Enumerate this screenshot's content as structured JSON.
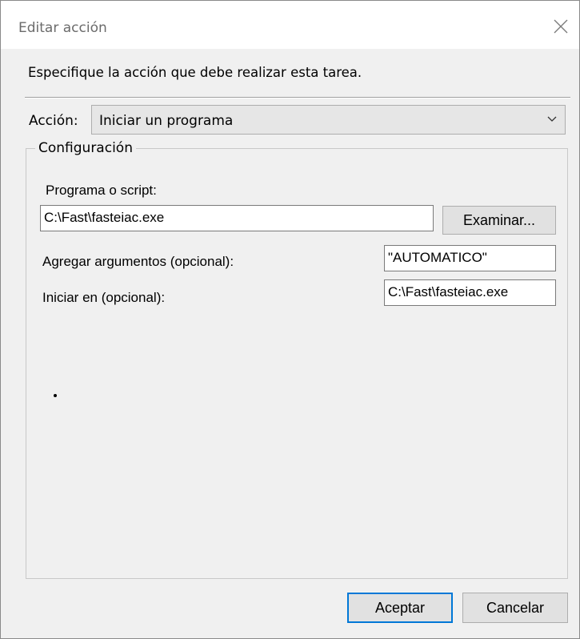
{
  "window": {
    "title": "Editar acción",
    "close_icon": "close-icon"
  },
  "instruction": "Especifique la acción que debe realizar esta tarea.",
  "action": {
    "label": "Acción:",
    "selected": "Iniciar un programa",
    "arrow_icon": "chevron-down-icon"
  },
  "config": {
    "legend": "Configuración",
    "program_label": "Programa o script:",
    "program_value": "C:\\Fast\\fasteiac.exe",
    "browse_label": "Examinar...",
    "args_label": "Agregar argumentos (opcional):",
    "args_value": "\"AUTOMATICO\"",
    "start_label": "Iniciar en (opcional):",
    "start_value": "C:\\Fast\\fasteiac.exe"
  },
  "buttons": {
    "ok": "Aceptar",
    "cancel": "Cancelar"
  },
  "colors": {
    "accent": "#0078d7",
    "dialog_bg": "#f0f0f0"
  }
}
